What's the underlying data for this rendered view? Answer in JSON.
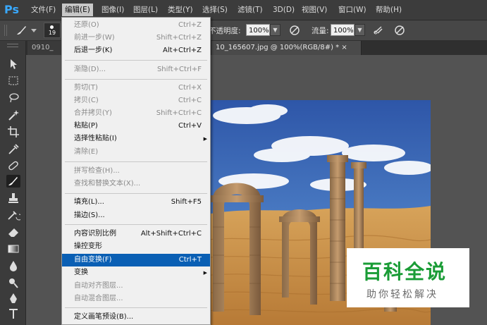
{
  "app": {
    "logo": "Ps"
  },
  "menubar": [
    {
      "label": "文件(F)"
    },
    {
      "label": "编辑(E)"
    },
    {
      "label": "图像(I)"
    },
    {
      "label": "图层(L)"
    },
    {
      "label": "类型(Y)"
    },
    {
      "label": "选择(S)"
    },
    {
      "label": "滤镜(T)"
    },
    {
      "label": "3D(D)"
    },
    {
      "label": "视图(V)"
    },
    {
      "label": "窗口(W)"
    },
    {
      "label": "帮助(H)"
    }
  ],
  "options_bar": {
    "brush_size": "19",
    "opacity_label": "不透明度:",
    "opacity_value": "100%",
    "flow_label": "流量:",
    "flow_value": "100%"
  },
  "tabs": [
    {
      "label": "0910_"
    },
    {
      "label": "10_165607.jpg @ 100%(RGB/8#) *  ×"
    }
  ],
  "edit_menu": {
    "items": [
      {
        "label": "还原(O)",
        "shortcut": "Ctrl+Z",
        "disabled": true
      },
      {
        "label": "前进一步(W)",
        "shortcut": "Shift+Ctrl+Z",
        "disabled": true
      },
      {
        "label": "后退一步(K)",
        "shortcut": "Alt+Ctrl+Z",
        "disabled": false
      },
      {
        "label": "渐隐(D)...",
        "shortcut": "Shift+Ctrl+F",
        "disabled": true
      },
      {
        "label": "剪切(T)",
        "shortcut": "Ctrl+X",
        "disabled": true
      },
      {
        "label": "拷贝(C)",
        "shortcut": "Ctrl+C",
        "disabled": true
      },
      {
        "label": "合并拷贝(Y)",
        "shortcut": "Shift+Ctrl+C",
        "disabled": true
      },
      {
        "label": "粘贴(P)",
        "shortcut": "Ctrl+V",
        "disabled": false
      },
      {
        "label": "选择性粘贴(I)",
        "shortcut": "",
        "disabled": false,
        "submenu": true
      },
      {
        "label": "清除(E)",
        "shortcut": "",
        "disabled": true
      },
      {
        "label": "拼写检查(H)...",
        "shortcut": "",
        "disabled": true
      },
      {
        "label": "查找和替换文本(X)...",
        "shortcut": "",
        "disabled": true
      },
      {
        "label": "填充(L)...",
        "shortcut": "Shift+F5",
        "disabled": false
      },
      {
        "label": "描边(S)...",
        "shortcut": "",
        "disabled": false
      },
      {
        "label": "内容识别比例",
        "shortcut": "Alt+Shift+Ctrl+C",
        "disabled": false
      },
      {
        "label": "操控变形",
        "shortcut": "",
        "disabled": false
      },
      {
        "label": "自由变换(F)",
        "shortcut": "Ctrl+T",
        "disabled": false,
        "highlight": true
      },
      {
        "label": "变换",
        "shortcut": "",
        "disabled": false,
        "submenu": true
      },
      {
        "label": "自动对齐图层...",
        "shortcut": "",
        "disabled": true
      },
      {
        "label": "自动混合图层...",
        "shortcut": "",
        "disabled": true
      },
      {
        "label": "定义画笔预设(B)...",
        "shortcut": "",
        "disabled": false
      }
    ]
  },
  "watermark": {
    "title": "百科全说",
    "subtitle": "助你轻松解决"
  }
}
